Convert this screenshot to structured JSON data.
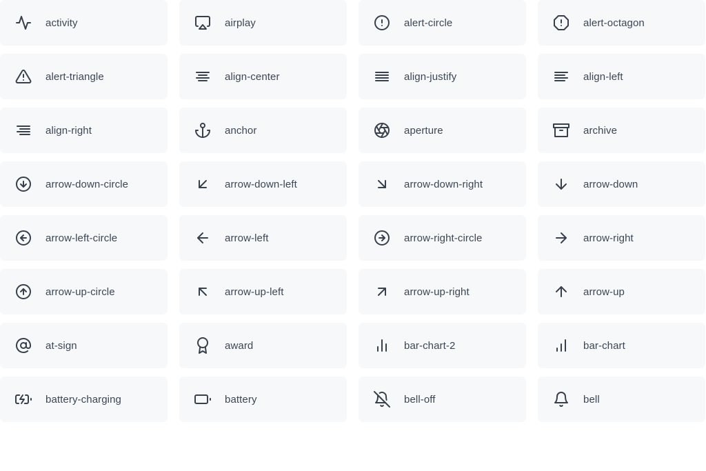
{
  "page": {
    "title": "Feather Icon Gallery",
    "background_color": "#ffffff",
    "card_background_color": "#f7f8fa",
    "icon_color": "#38404c",
    "label_color": "#3c4654",
    "columns": 4,
    "total_visible_cards": 32
  },
  "cards": [
    {
      "icon": "activity-icon",
      "label": "activity"
    },
    {
      "icon": "airplay-icon",
      "label": "airplay"
    },
    {
      "icon": "alert-circle-icon",
      "label": "alert-circle"
    },
    {
      "icon": "alert-octagon-icon",
      "label": "alert-octagon"
    },
    {
      "icon": "alert-triangle-icon",
      "label": "alert-triangle"
    },
    {
      "icon": "align-center-icon",
      "label": "align-center"
    },
    {
      "icon": "align-justify-icon",
      "label": "align-justify"
    },
    {
      "icon": "align-left-icon",
      "label": "align-left"
    },
    {
      "icon": "align-right-icon",
      "label": "align-right"
    },
    {
      "icon": "anchor-icon",
      "label": "anchor"
    },
    {
      "icon": "aperture-icon",
      "label": "aperture"
    },
    {
      "icon": "archive-icon",
      "label": "archive"
    },
    {
      "icon": "arrow-down-circle-icon",
      "label": "arrow-down-circle"
    },
    {
      "icon": "arrow-down-left-icon",
      "label": "arrow-down-left"
    },
    {
      "icon": "arrow-down-right-icon",
      "label": "arrow-down-right"
    },
    {
      "icon": "arrow-down-icon",
      "label": "arrow-down"
    },
    {
      "icon": "arrow-left-circle-icon",
      "label": "arrow-left-circle"
    },
    {
      "icon": "arrow-left-icon",
      "label": "arrow-left"
    },
    {
      "icon": "arrow-right-circle-icon",
      "label": "arrow-right-circle"
    },
    {
      "icon": "arrow-right-icon",
      "label": "arrow-right"
    },
    {
      "icon": "arrow-up-circle-icon",
      "label": "arrow-up-circle"
    },
    {
      "icon": "arrow-up-left-icon",
      "label": "arrow-up-left"
    },
    {
      "icon": "arrow-up-right-icon",
      "label": "arrow-up-right"
    },
    {
      "icon": "arrow-up-icon",
      "label": "arrow-up"
    },
    {
      "icon": "at-sign-icon",
      "label": "at-sign"
    },
    {
      "icon": "award-icon",
      "label": "award"
    },
    {
      "icon": "bar-chart-2-icon",
      "label": "bar-chart-2"
    },
    {
      "icon": "bar-chart-icon",
      "label": "bar-chart"
    },
    {
      "icon": "battery-charging-icon",
      "label": "battery-charging"
    },
    {
      "icon": "battery-icon",
      "label": "battery"
    },
    {
      "icon": "bell-off-icon",
      "label": "bell-off"
    },
    {
      "icon": "bell-icon",
      "label": "bell"
    }
  ]
}
